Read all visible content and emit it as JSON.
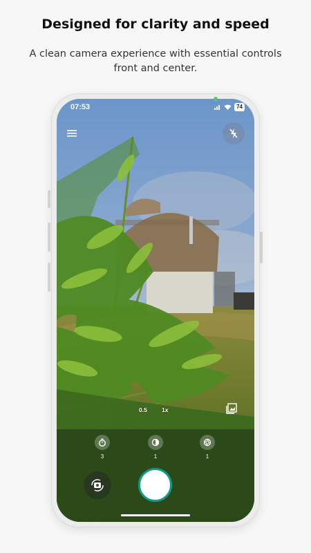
{
  "promo": {
    "headline": "Designed for clarity and speed",
    "subline": "A clean camera experience with essential controls front and center."
  },
  "status_bar": {
    "time": "07:53",
    "battery": "74",
    "icons": [
      "signal-icon",
      "wifi-icon",
      "battery-icon"
    ]
  },
  "camera": {
    "top_controls": [
      "menu-icon",
      "flash-off-icon"
    ],
    "zoom_options": [
      {
        "label": "0.5"
      },
      {
        "label": "1x",
        "selected": true
      }
    ],
    "tools": [
      {
        "icon": "timer-icon",
        "value": "3"
      },
      {
        "icon": "exposure-icon",
        "value": "1"
      },
      {
        "icon": "aperture-icon",
        "value": "1"
      }
    ],
    "accent_color": "#0e9d87"
  }
}
